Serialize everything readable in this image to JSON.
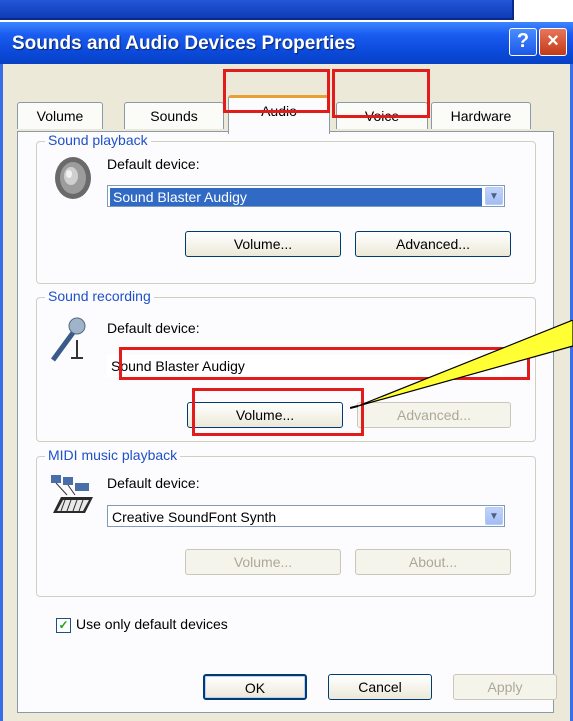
{
  "window": {
    "title": "Sounds and Audio Devices Properties",
    "help_glyph": "?",
    "close_glyph": "×"
  },
  "tabs": [
    {
      "label": "Volume"
    },
    {
      "label": "Sounds"
    },
    {
      "label": "Audio"
    },
    {
      "label": "Voice"
    },
    {
      "label": "Hardware"
    }
  ],
  "playback": {
    "group": "Sound playback",
    "label": "Default device:",
    "device": "Sound Blaster Audigy",
    "volume": "Volume...",
    "advanced": "Advanced..."
  },
  "recording": {
    "group": "Sound recording",
    "label": "Default device:",
    "device": "Sound Blaster Audigy",
    "volume": "Volume...",
    "advanced": "Advanced..."
  },
  "midi": {
    "group": "MIDI music playback",
    "label": "Default device:",
    "device": "Creative SoundFont Synth",
    "volume": "Volume...",
    "about": "About..."
  },
  "use_default": {
    "label": "Use only default devices",
    "checked": true,
    "mark": "✓"
  },
  "footer": {
    "ok": "OK",
    "cancel": "Cancel",
    "apply": "Apply"
  },
  "colors": {
    "highlight": "#e21b1b",
    "arrow": "#ffff33",
    "title": "#0a48d8"
  }
}
